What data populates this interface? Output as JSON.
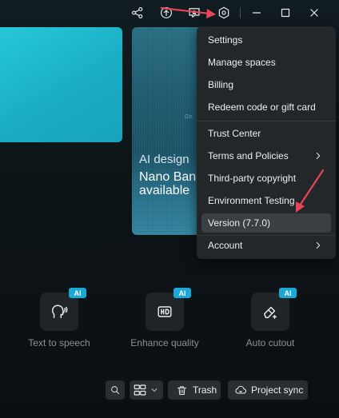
{
  "menu": {
    "items": [
      {
        "label": "Settings"
      },
      {
        "label": "Manage spaces"
      },
      {
        "label": "Billing"
      },
      {
        "label": "Redeem code or gift card"
      },
      {
        "label": "Trust Center"
      },
      {
        "label": "Terms and Policies"
      },
      {
        "label": "Third-party copyright"
      },
      {
        "label": "Environment Testing"
      },
      {
        "label": "Version (7.7.0)"
      },
      {
        "label": "Account"
      }
    ]
  },
  "promo": {
    "title": "AI design",
    "subtitle_line1": "Nano Ban",
    "subtitle_line2": "available",
    "tiny": "Ge"
  },
  "tools": [
    {
      "label": "Text to speech",
      "badge": "AI",
      "icon": "voice-icon"
    },
    {
      "label": "Enhance quality",
      "badge": "AI",
      "icon": "hd-icon"
    },
    {
      "label": "Auto cutout",
      "badge": "AI",
      "icon": "eraser-icon"
    }
  ],
  "bottom_bar": {
    "trash_label": "Trash",
    "sync_label": "Project sync"
  },
  "colors": {
    "accent_ai": "#1aa9d6",
    "arrow": "#e8455a",
    "menu_bg": "#232729",
    "card_cyan": "#1fb8cd"
  }
}
